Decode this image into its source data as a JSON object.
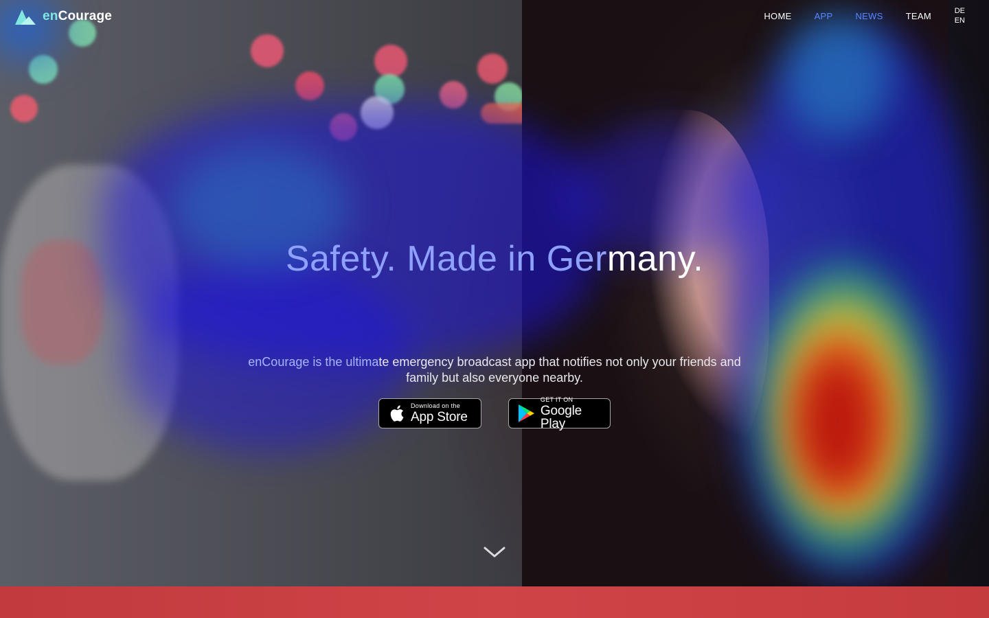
{
  "brand": {
    "prefix": "en",
    "suffix": "Courage",
    "accent": "#7fe6e0"
  },
  "nav": {
    "items": [
      {
        "label": "HOME"
      },
      {
        "label": "APP"
      },
      {
        "label": "NEWS"
      },
      {
        "label": "TEAM"
      }
    ],
    "languages": [
      "DE",
      "EN"
    ]
  },
  "hero": {
    "headline_part1": "Safety. Made in Ger",
    "headline_part2": "many.",
    "subtext_part1": "enCourage is the ultima",
    "subtext_part2": "te emergency broadcast app that notifies not only your friends and family but also everyone nearby."
  },
  "badges": {
    "apple": {
      "small": "Download on the",
      "big": "App Store",
      "icon": "apple-icon"
    },
    "play": {
      "small": "GET IT ON",
      "big": "Google Play",
      "icon": "google-play-icon"
    }
  },
  "scroll_indicator": {
    "icon": "chevron-down-icon"
  },
  "colors": {
    "footer_bar": "#cf4447",
    "nav_highlight": "#5a86ff"
  }
}
